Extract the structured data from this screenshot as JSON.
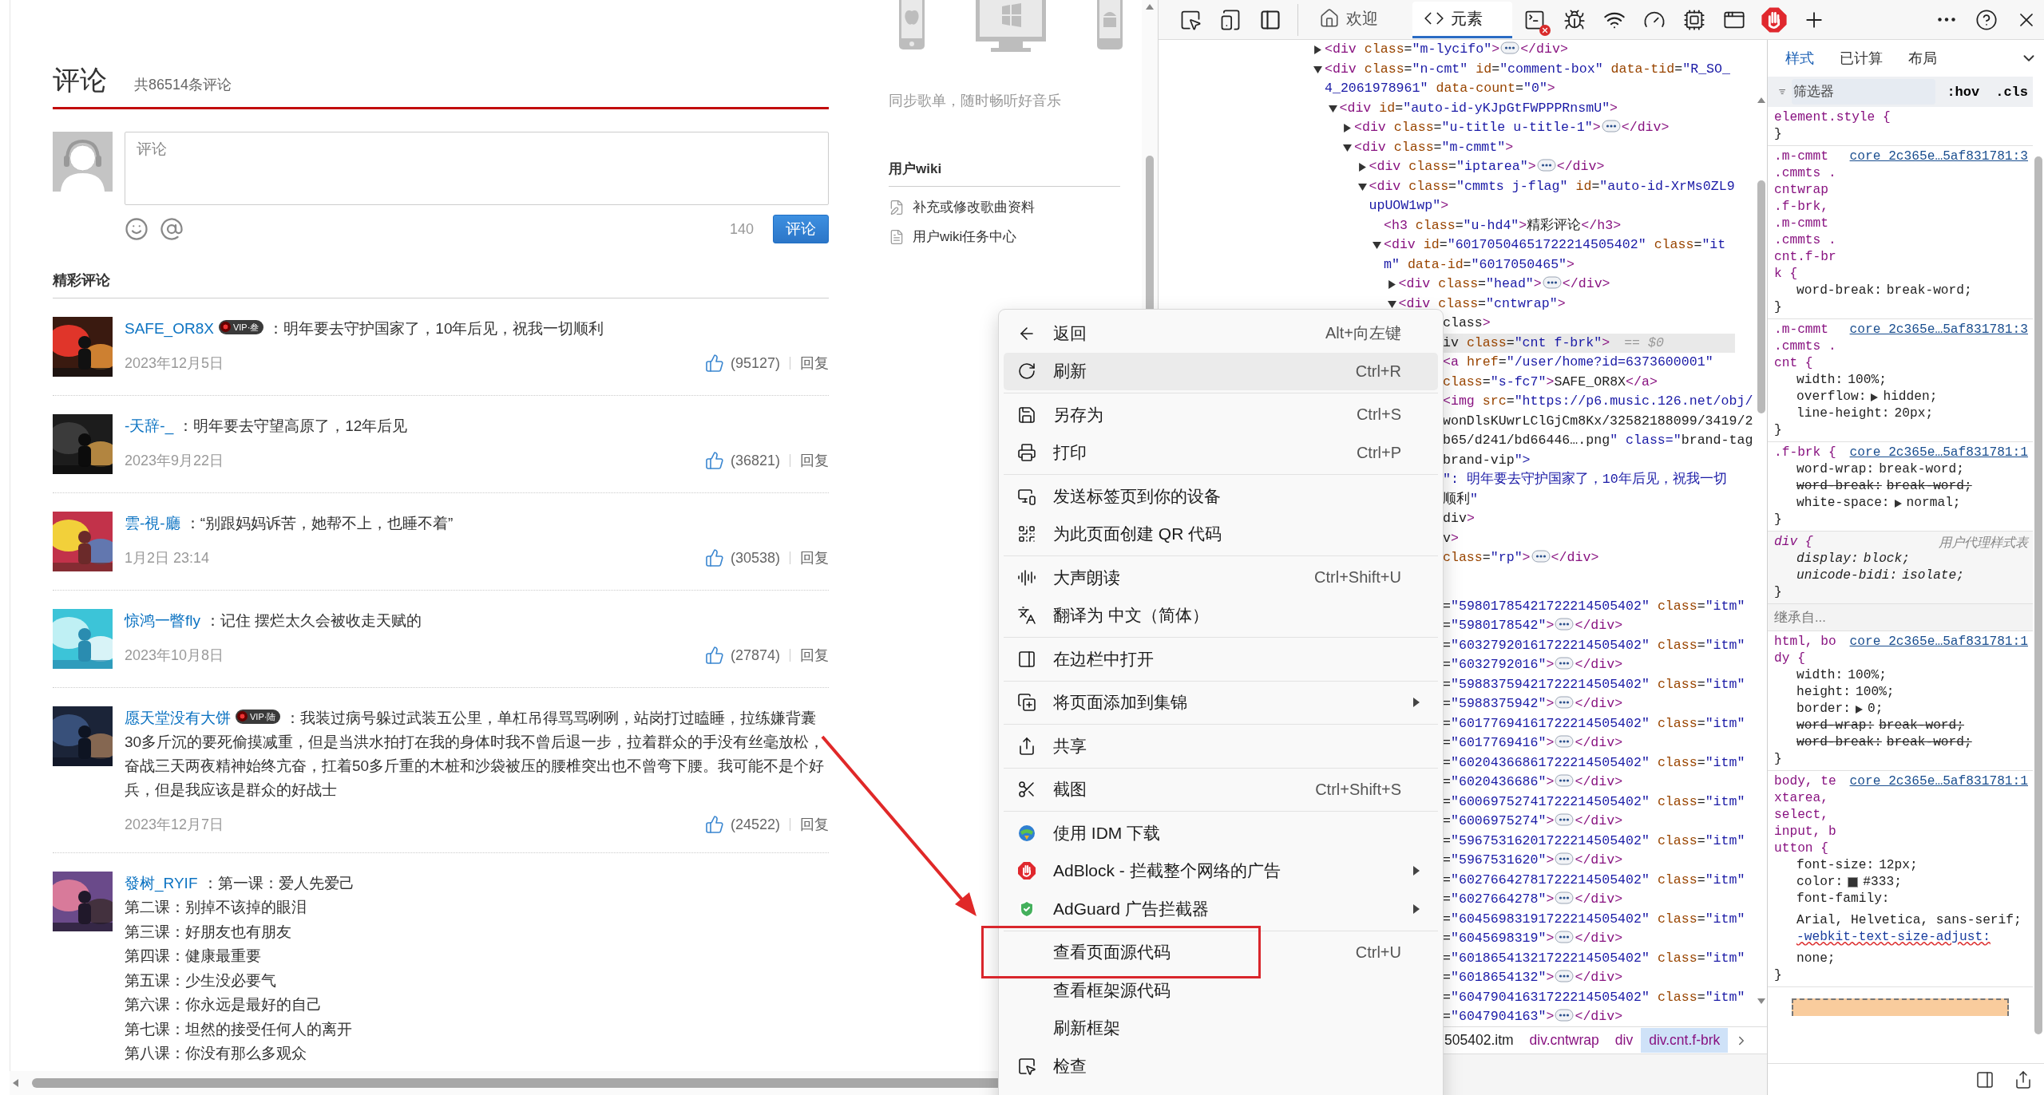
{
  "page": {
    "comments": {
      "title": "评论",
      "total": "共86514条评论",
      "input": {
        "placeholder": "评论"
      },
      "remaining": "140",
      "submit": "评论",
      "featured_title": "精彩评论",
      "items": [
        {
          "user": "SAFE_OR8X",
          "vip": "VIP·叁",
          "text": "：明年要去守护国家了，10年后见，祝我一切顺利",
          "date": "2023年12月5日",
          "likes": "(95127)",
          "reply": "回复"
        },
        {
          "user": "-天辞-_",
          "text": "：明年要去守望高原了，12年后见",
          "date": "2023年9月22日",
          "likes": "(36821)",
          "reply": "回复"
        },
        {
          "user": "雲-視-廳",
          "text": "：“别跟妈妈诉苦，她帮不上，也睡不着”",
          "date": "1月2日 23:14",
          "likes": "(30538)",
          "reply": "回复"
        },
        {
          "user": "惊鸿一瞥fly",
          "text": "：记住 摆烂太久会被收走天赋的",
          "date": "2023年10月8日",
          "likes": "(27874)",
          "reply": "回复"
        },
        {
          "user": "愿天堂没有大饼",
          "vip": "VIP·陆",
          "text": "：我装过病号躲过武装五公里，单杠吊得骂骂咧咧，站岗打过瞌睡，拉练嫌背囊30多斤沉的要死偷摸减重，但是当洪水拍打在我的身体时我不曾后退一步，拉着群众的手没有丝毫放松，奋战三天两夜精神始终亢奋，扛着50多斤重的木桩和沙袋被压的腰椎突出也不曾弯下腰。我可能不是个好兵，但是我应该是群众的好战士",
          "date": "2023年12月7日",
          "likes": "(24522)",
          "reply": "回复"
        },
        {
          "user": "發树_RYIF",
          "text": "：第一课：爱人先爱己",
          "more_lines": [
            "第二课：别掉不该掉的眼泪",
            "第三课：好朋友也有朋友",
            "第四课：健康最重要",
            "第五课：少生没必要气",
            "第六课：你永远是最好的自己",
            "第七课：坦然的接受任何人的离开",
            "第八课：你没有那么多观众"
          ]
        }
      ]
    },
    "sidebar": {
      "tagline": "同步歌单，随时畅听好音乐",
      "wiki_title": "用户wiki",
      "wiki_links": [
        "补充或修改歌曲资料",
        "用户wiki任务中心"
      ]
    }
  },
  "context_menu": {
    "items": [
      {
        "kind": "item",
        "label": "返回",
        "shortcut": "Alt+向左键",
        "submenu": false,
        "hovered": false,
        "boxed": false
      },
      {
        "kind": "item",
        "label": "刷新",
        "shortcut": "Ctrl+R",
        "submenu": false,
        "hovered": true,
        "boxed": false
      },
      {
        "kind": "separator"
      },
      {
        "kind": "item",
        "label": "另存为",
        "shortcut": "Ctrl+S",
        "submenu": false,
        "hovered": false,
        "boxed": false
      },
      {
        "kind": "item",
        "label": "打印",
        "shortcut": "Ctrl+P",
        "submenu": false,
        "hovered": false,
        "boxed": false
      },
      {
        "kind": "separator"
      },
      {
        "kind": "item",
        "label": "发送标签页到你的设备",
        "submenu": false,
        "hovered": false,
        "boxed": false
      },
      {
        "kind": "item",
        "label": "为此页面创建 QR 代码",
        "submenu": false,
        "hovered": false,
        "boxed": false
      },
      {
        "kind": "separator"
      },
      {
        "kind": "item",
        "label": "大声朗读",
        "shortcut": "Ctrl+Shift+U",
        "submenu": false,
        "hovered": false,
        "boxed": false
      },
      {
        "kind": "item",
        "label": "翻译为 中文（简体）",
        "submenu": false,
        "hovered": false,
        "boxed": false
      },
      {
        "kind": "separator"
      },
      {
        "kind": "item",
        "label": "在边栏中打开",
        "submenu": false,
        "hovered": false,
        "boxed": false
      },
      {
        "kind": "separator"
      },
      {
        "kind": "item",
        "label": "将页面添加到集锦",
        "submenu": true,
        "hovered": false,
        "boxed": false
      },
      {
        "kind": "separator"
      },
      {
        "kind": "item",
        "label": "共享",
        "submenu": false,
        "hovered": false,
        "boxed": false
      },
      {
        "kind": "separator"
      },
      {
        "kind": "item",
        "label": "截图",
        "shortcut": "Ctrl+Shift+S",
        "submenu": false,
        "hovered": false,
        "boxed": false
      },
      {
        "kind": "separator"
      },
      {
        "kind": "item",
        "label": "使用 IDM 下载",
        "submenu": false,
        "hovered": false,
        "boxed": false
      },
      {
        "kind": "item",
        "label": "AdBlock - 拦截整个网络的广告",
        "submenu": true,
        "hovered": false,
        "boxed": false
      },
      {
        "kind": "item",
        "label": "AdGuard 广告拦截器",
        "submenu": true,
        "hovered": false,
        "boxed": false
      },
      {
        "kind": "separator"
      },
      {
        "kind": "item",
        "label": "查看页面源代码",
        "shortcut": "Ctrl+U",
        "submenu": false,
        "hovered": false,
        "boxed": true
      },
      {
        "kind": "item",
        "label": "查看框架源代码",
        "submenu": false,
        "hovered": false,
        "boxed": false
      },
      {
        "kind": "item",
        "label": "刷新框架",
        "submenu": false,
        "hovered": false,
        "boxed": false
      },
      {
        "kind": "item",
        "label": "检查",
        "submenu": false,
        "hovered": false,
        "boxed": false
      }
    ]
  },
  "devtools": {
    "tabs": [
      {
        "label": "欢迎",
        "selected": false
      },
      {
        "label": "元素",
        "selected": true
      }
    ],
    "elements": {
      "nodes": [
        {
          "kind": "parent",
          "tag": "<div class=\"m-lycifo\">",
          "expanded": false,
          "tail": "</div>"
        },
        {
          "kind": "parent",
          "tag": "<div class=\"n-cmt\" id=\"comment-box\" data-tid=\"R_SO_4_2061978961\" data-count=\"0\">",
          "expanded": true,
          "children": [
            {
              "kind": "parent",
              "tag": "<div id=\"auto-id-yKJpGtFWPPPRnsmU\">",
              "expanded": true,
              "children": [
                {
                  "kind": "parent",
                  "tag": "<div class=\"u-title u-title-1\">",
                  "expanded": false,
                  "tail": "</div>"
                },
                {
                  "kind": "parent",
                  "tag": "<div class=\"m-cmmt\">",
                  "expanded": true,
                  "children": [
                    {
                      "kind": "parent",
                      "tag": "<div class=\"iptarea\">",
                      "expanded": false,
                      "tail": "</div>"
                    },
                    {
                      "kind": "parent",
                      "tag": "<div class=\"cmmts j-flag\" id=\"auto-id-XrMs0ZL9upUOW1wp\">",
                      "expanded": true,
                      "children": [
                        {
                          "kind": "leaf",
                          "tag": "<h3 class=\"u-hd4\">精彩评论</h3>"
                        },
                        {
                          "kind": "parent",
                          "tag": "<div id=\"60170504651722214505402\" class=\"itm\" data-id=\"6017050465\">",
                          "expanded": true,
                          "children": [
                            {
                              "kind": "parent",
                              "tag": "<div class=\"head\">",
                              "expanded": false,
                              "tail": "</div>"
                            },
                            {
                              "kind": "parent",
                              "tag": "<div class=\"cntwrap\">",
                              "expanded": true
                            }
                          ]
                        }
                      ]
                    }
                  ]
                }
              ]
            }
          ]
        }
      ],
      "cut_rows": [
        {
          "text": "class>",
          "selected": false
        },
        {
          "text": "iv class=\"cnt f-brk\">",
          "selected": true,
          "hint": "== $0"
        },
        {
          "text": "<a href=\"/user/home?id=6373600001\"",
          "selected": false
        },
        {
          "text": "class=\"s-fc7\">SAFE_OR8X</a>",
          "selected": false
        },
        {
          "text": "<img src=\"https://p6.music.126.net/obj/",
          "selected": false
        },
        {
          "text": "wonDlsKUwrLClGjCm8Kx/32582188099/3419/2",
          "selected": false
        },
        {
          "text": "b65/d241/bd66446….png\" class=\"brand-tag",
          "selected": false
        },
        {
          "text": "brand-vip\">",
          "selected": false
        },
        {
          "text": "\": 明年要去守护国家了，10年后见，祝我一切",
          "selected": false
        },
        {
          "text": "顺利\"",
          "selected": false
        },
        {
          "text": "div>",
          "selected": false
        },
        {
          "text": "v>",
          "selected": false
        },
        {
          "text": "class=\"rp\">",
          "selected": false,
          "tail": "</div>"
        }
      ],
      "item_rows": [
        {
          "open": "=\"59801785421722214505402\" class=\"itm\"",
          "close": "=\"5980178542\">",
          "tail": "</div>"
        },
        {
          "open": "=\"60327920161722214505402\" class=\"itm\"",
          "close": "=\"6032792016\">",
          "tail": "</div>"
        },
        {
          "open": "=\"59883759421722214505402\" class=\"itm\"",
          "close": "=\"5988375942\">",
          "tail": "</div>"
        },
        {
          "open": "=\"60177694161722214505402\" class=\"itm\"",
          "close": "=\"6017769416\">",
          "tail": "</div>"
        },
        {
          "open": "=\"60204366861722214505402\" class=\"itm\"",
          "close": "=\"6020436686\">",
          "tail": "</div>"
        },
        {
          "open": "=\"60069752741722214505402\" class=\"itm\"",
          "close": "=\"6006975274\">",
          "tail": "</div>"
        },
        {
          "open": "=\"59675316201722214505402\" class=\"itm\"",
          "close": "=\"5967531620\">",
          "tail": "</div>"
        },
        {
          "open": "=\"60276642781722214505402\" class=\"itm\"",
          "close": "=\"6027664278\">",
          "tail": "</div>"
        },
        {
          "open": "=\"60456983191722214505402\" class=\"itm\"",
          "close": "=\"6045698319\">",
          "tail": "</div>"
        },
        {
          "open": "=\"60186541321722214505402\" class=\"itm\"",
          "close": "=\"6018654132\">",
          "tail": "</div>"
        },
        {
          "open": "=\"60479041631722214505402\" class=\"itm\"",
          "close": "=\"6047904163\">",
          "tail": "</div>"
        }
      ],
      "breadcrumbs": [
        {
          "label": "505402.itm",
          "selected": false
        },
        {
          "label": "div.cntwrap",
          "selected": false
        },
        {
          "label": "div",
          "selected": false
        },
        {
          "label": "div.cnt.f-brk",
          "selected": true
        }
      ]
    },
    "styles": {
      "tabs": [
        {
          "label": "样式",
          "selected": true
        },
        {
          "label": "已计算",
          "selected": false
        },
        {
          "label": "布局",
          "selected": false
        }
      ],
      "filter": {
        "placeholder": "筛选器"
      },
      "toggles": [
        ":hov",
        ".cls"
      ],
      "rules": [
        {
          "kind": "rule",
          "selector": "element.style {",
          "end": "}"
        },
        {
          "kind": "rule",
          "selector": ".m-cmmt .cmmts .cntwrap .f-brk, .m-cmmt .cmmts .cnt.f-brk {",
          "source": "core_2c365e…5af831781:3",
          "end": "}",
          "declarations": [
            {
              "name": "word-break:",
              "value": "break-word;",
              "overridden": false
            }
          ]
        },
        {
          "kind": "rule",
          "selector": ".m-cmmt .cmmts .cnt {",
          "source": "core_2c365e…5af831781:3",
          "end": "}",
          "declarations": [
            {
              "name": "width:",
              "value": "100%;",
              "overridden": false
            },
            {
              "name": "overflow:",
              "value": "hidden;",
              "expandable": true,
              "overridden": false
            },
            {
              "name": "line-height:",
              "value": "20px;",
              "overridden": false
            }
          ]
        },
        {
          "kind": "rule",
          "selector": ".f-brk {",
          "source": "core_2c365e…5af831781:1",
          "end": "}",
          "declarations": [
            {
              "name": "word-wrap:",
              "value": "break-word;",
              "overridden": false
            },
            {
              "name": "word-break:",
              "value": "break-word;",
              "overridden": true
            },
            {
              "name": "white-space:",
              "value": "normal;",
              "expandable": true,
              "overridden": false
            }
          ]
        },
        {
          "kind": "user_agent",
          "selector": "div {",
          "source": "用户代理样式表",
          "end": "}",
          "declarations": [
            {
              "name": "display:",
              "value": "block;",
              "overridden": false
            },
            {
              "name": "unicode-bidi:",
              "value": "isolate;",
              "overridden": false
            }
          ]
        },
        {
          "kind": "inherited",
          "label": "继承自..."
        },
        {
          "kind": "rule",
          "selector": "html, body {",
          "source": "core_2c365e…5af831781:1",
          "end": "}",
          "declarations": [
            {
              "name": "width:",
              "value": "100%;",
              "overridden": false
            },
            {
              "name": "height:",
              "value": "100%;",
              "overridden": false
            },
            {
              "name": "border:",
              "value": "0;",
              "expandable": true,
              "overridden": false
            },
            {
              "name": "word-wrap:",
              "value": "break-word;",
              "overridden": true
            },
            {
              "name": "word-break:",
              "value": "break-word;",
              "overridden": true
            }
          ]
        },
        {
          "kind": "rule",
          "selector": "body, textarea, select, input, button {",
          "source": "core_2c365e…5af831781:1",
          "end": "}",
          "declarations": [
            {
              "name": "font-size:",
              "value": "12px;",
              "overridden": false
            },
            {
              "name": "color:",
              "value": "#333;",
              "swatch": true,
              "overridden": false
            },
            {
              "name": "font-family:",
              "value": "Arial, Helvetica, sans-serif;",
              "overridden": false
            },
            {
              "name": "-webkit-text-size-adjust:",
              "value": "none;",
              "invalid": true,
              "overridden": false
            }
          ]
        }
      ]
    }
  }
}
